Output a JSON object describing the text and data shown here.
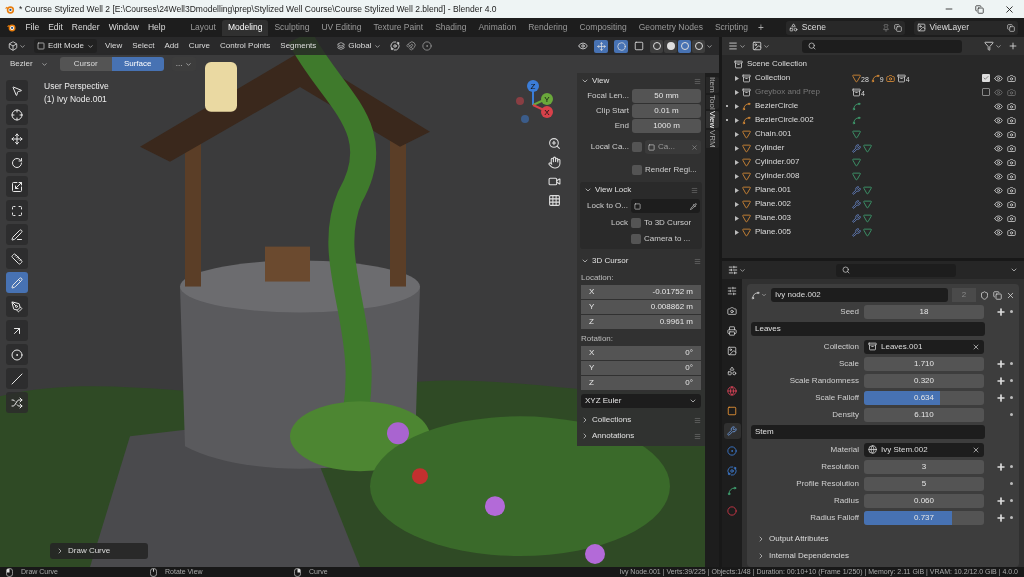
{
  "window": {
    "title": "* Course Stylized Well 2 [E:\\Courses\\24Well3Dmodelling\\prep\\Stylized Well Course\\Course Stylized Well 2.blend] - Blender 4.0"
  },
  "menu": [
    "File",
    "Edit",
    "Render",
    "Window",
    "Help"
  ],
  "workspaces": [
    {
      "label": "Layout",
      "selected": false
    },
    {
      "label": "Modeling",
      "selected": true
    },
    {
      "label": "Sculpting",
      "selected": false
    },
    {
      "label": "UV Editing",
      "selected": false
    },
    {
      "label": "Texture Paint",
      "selected": false
    },
    {
      "label": "Shading",
      "selected": false
    },
    {
      "label": "Animation",
      "selected": false
    },
    {
      "label": "Rendering",
      "selected": false
    },
    {
      "label": "Compositing",
      "selected": false
    },
    {
      "label": "Geometry Nodes",
      "selected": false
    },
    {
      "label": "Scripting",
      "selected": false
    }
  ],
  "add_workspace": "+",
  "scene": "Scene",
  "view_layer": "ViewLayer",
  "viewport": {
    "mode": "Edit Mode",
    "menus": [
      "View",
      "Select",
      "Add",
      "Curve",
      "Control Points",
      "Segments"
    ],
    "orientation": "Global",
    "shading": [
      {
        "selected": false
      },
      {
        "selected": false
      },
      {
        "selected": true
      },
      {
        "selected": false
      }
    ],
    "curve_type": "Bezier",
    "depth_options": [
      {
        "label": "Cursor",
        "selected": false
      },
      {
        "label": "Surface",
        "selected": true
      }
    ],
    "more": "...",
    "perspective": "User Perspective",
    "object": "(1) Ivy Node.001",
    "tools": [
      {
        "kind": "select",
        "selected": false
      },
      {
        "kind": "cursor",
        "selected": false
      },
      {
        "kind": "move",
        "selected": false
      },
      {
        "kind": "rotate",
        "selected": false
      },
      {
        "kind": "scale",
        "selected": false
      },
      {
        "kind": "transform",
        "selected": false
      },
      {
        "kind": "annotate",
        "selected": false
      },
      {
        "kind": "measure",
        "selected": false
      },
      {
        "kind": "draw",
        "selected": true
      },
      {
        "kind": "pen",
        "selected": false
      },
      {
        "kind": "extrude",
        "selected": false
      },
      {
        "kind": "radius",
        "selected": false
      },
      {
        "kind": "tilt",
        "selected": false
      },
      {
        "kind": "randomize",
        "selected": false
      }
    ],
    "gizmo": [
      "Z",
      "Y",
      "X"
    ],
    "last_operator": "Draw Curve"
  },
  "sidebar": {
    "tabs": [
      {
        "label": "Item",
        "selected": false
      },
      {
        "label": "Tool",
        "selected": false
      },
      {
        "label": "View",
        "selected": true
      },
      {
        "label": "VRM",
        "selected": false
      }
    ],
    "view": {
      "title": "View",
      "expanded": true,
      "rows": [
        {
          "label": "Focal Len...",
          "value": "50 mm"
        },
        {
          "label": "Clip Start",
          "value": "0.01 m"
        },
        {
          "label": "End",
          "value": "1000 m"
        }
      ],
      "local_camera": {
        "label": "Local Ca...",
        "checked": false,
        "value": "Ca..."
      },
      "render_region": {
        "label": "Render Regi...",
        "checked": false
      }
    },
    "view_lock": {
      "title": "View Lock",
      "expanded": true,
      "lock_to": "Lock to O...",
      "lock": "Lock",
      "options": [
        {
          "label": "To 3D Cursor",
          "checked": false
        },
        {
          "label": "Camera to ...",
          "checked": false
        }
      ]
    },
    "cursor": {
      "title": "3D Cursor",
      "expanded": true,
      "location_label": "Location:",
      "location": [
        {
          "axis": "X",
          "value": "-0.01752 m"
        },
        {
          "axis": "Y",
          "value": "0.008862 m"
        },
        {
          "axis": "Z",
          "value": "0.9961 m"
        }
      ],
      "rotation_label": "Rotation:",
      "rotation": [
        {
          "axis": "X",
          "value": "0°"
        },
        {
          "axis": "Y",
          "value": "0°"
        },
        {
          "axis": "Z",
          "value": "0°"
        }
      ],
      "rotation_mode": "XYZ Euler"
    },
    "collapsed": [
      {
        "title": "Collections",
        "expanded": false
      },
      {
        "title": "Annotations",
        "expanded": false
      }
    ]
  },
  "outliner": {
    "root": "Scene Collection",
    "items": [
      {
        "name": "Collection",
        "kind": "collection",
        "checked": true,
        "editing": false,
        "badges": [
          {
            "kind": "mesh",
            "count": "28"
          },
          {
            "kind": "curve",
            "count": "9"
          },
          {
            "kind": "camera"
          },
          {
            "kind": "collection",
            "count": "4"
          }
        ]
      },
      {
        "name": "Greybox and Prep",
        "kind": "collection",
        "checked": false,
        "editing": false,
        "badges": [
          {
            "kind": "collection",
            "count": "4"
          }
        ]
      },
      {
        "name": "BezierCircle",
        "kind": "curve",
        "editing": true,
        "badges": [
          {
            "kind": "curve_data"
          }
        ]
      },
      {
        "name": "BezierCircle.002",
        "kind": "curve",
        "editing": true,
        "badges": [
          {
            "kind": "curve_data"
          }
        ]
      },
      {
        "name": "Chain.001",
        "kind": "mesh",
        "editing": false,
        "badges": [
          {
            "kind": "mesh_data"
          }
        ]
      },
      {
        "name": "Cylinder",
        "kind": "mesh",
        "editing": false,
        "badges": [
          {
            "kind": "modifier"
          },
          {
            "kind": "mesh_data"
          }
        ]
      },
      {
        "name": "Cylinder.007",
        "kind": "mesh",
        "editing": false,
        "badges": [
          {
            "kind": "mesh_data"
          }
        ]
      },
      {
        "name": "Cylinder.008",
        "kind": "mesh",
        "editing": false,
        "badges": [
          {
            "kind": "mesh_data"
          }
        ]
      },
      {
        "name": "Plane.001",
        "kind": "mesh",
        "editing": false,
        "badges": [
          {
            "kind": "modifier"
          },
          {
            "kind": "mesh_data"
          }
        ]
      },
      {
        "name": "Plane.002",
        "kind": "mesh",
        "editing": false,
        "badges": [
          {
            "kind": "modifier"
          },
          {
            "kind": "mesh_data"
          }
        ]
      },
      {
        "name": "Plane.003",
        "kind": "mesh",
        "editing": false,
        "badges": [
          {
            "kind": "modifier"
          },
          {
            "kind": "mesh_data"
          }
        ]
      },
      {
        "name": "Plane.005",
        "kind": "mesh",
        "editing": false,
        "badges": [
          {
            "kind": "modifier"
          },
          {
            "kind": "mesh_data"
          }
        ]
      }
    ]
  },
  "properties": {
    "tabs": [
      {
        "kind": "tool",
        "selected": false
      },
      {
        "kind": "render",
        "selected": false
      },
      {
        "kind": "output",
        "selected": false
      },
      {
        "kind": "view_layer",
        "selected": false
      },
      {
        "kind": "scene",
        "selected": false
      },
      {
        "kind": "world",
        "selected": false
      },
      {
        "kind": "object",
        "selected": false
      },
      {
        "kind": "modifier",
        "selected": true
      },
      {
        "kind": "particles",
        "selected": false
      },
      {
        "kind": "physics",
        "selected": false
      },
      {
        "kind": "data",
        "selected": false
      },
      {
        "kind": "material",
        "selected": false
      }
    ],
    "modifier": {
      "name": "Ivy node.002",
      "users": "2"
    },
    "rows": [
      {
        "kind": "field",
        "label": "Seed",
        "value": "18",
        "animatable": true
      },
      {
        "kind": "section",
        "label": "Leaves"
      },
      {
        "kind": "collection",
        "label": "Collection",
        "value": "Leaves.001"
      },
      {
        "kind": "field",
        "label": "Scale",
        "value": "1.710",
        "animatable": true
      },
      {
        "kind": "field",
        "label": "Scale Randomness",
        "value": "0.320",
        "animatable": true
      },
      {
        "kind": "slider",
        "label": "Scale Falloff",
        "value": "0.634",
        "level": 0.634,
        "animatable": true
      },
      {
        "kind": "field",
        "label": "Density",
        "value": "6.110",
        "animatable": false
      },
      {
        "kind": "section",
        "label": "Stem"
      },
      {
        "kind": "material",
        "label": "Material",
        "value": "Ivy Stem.002"
      },
      {
        "kind": "field",
        "label": "Resolution",
        "value": "3",
        "animatable": true
      },
      {
        "kind": "field",
        "label": "Profile Resolution",
        "value": "5",
        "animatable": false
      },
      {
        "kind": "field",
        "label": "Radius",
        "value": "0.060",
        "animatable": true
      },
      {
        "kind": "slider",
        "label": "Radius Falloff",
        "value": "0.737",
        "level": 0.737,
        "animatable": true
      }
    ],
    "subpanels": [
      {
        "title": "Output Attributes",
        "expanded": false
      },
      {
        "title": "Internal Dependencies",
        "expanded": false
      }
    ]
  },
  "status_bar": {
    "hints": [
      {
        "kind": "left_mouse",
        "label": "Draw Curve"
      },
      {
        "kind": "middle_mouse",
        "label": "Rotate View"
      },
      {
        "kind": "right_mouse",
        "label": "Curve"
      }
    ],
    "info": "Ivy Node.001 | Verts:39/225 | Objects:1/48 | Duration: 00:10+10 (Frame 1/250) | Memory: 2.11 GiB | VRAM: 10.2/12.0 GiB | 4.0.0"
  }
}
